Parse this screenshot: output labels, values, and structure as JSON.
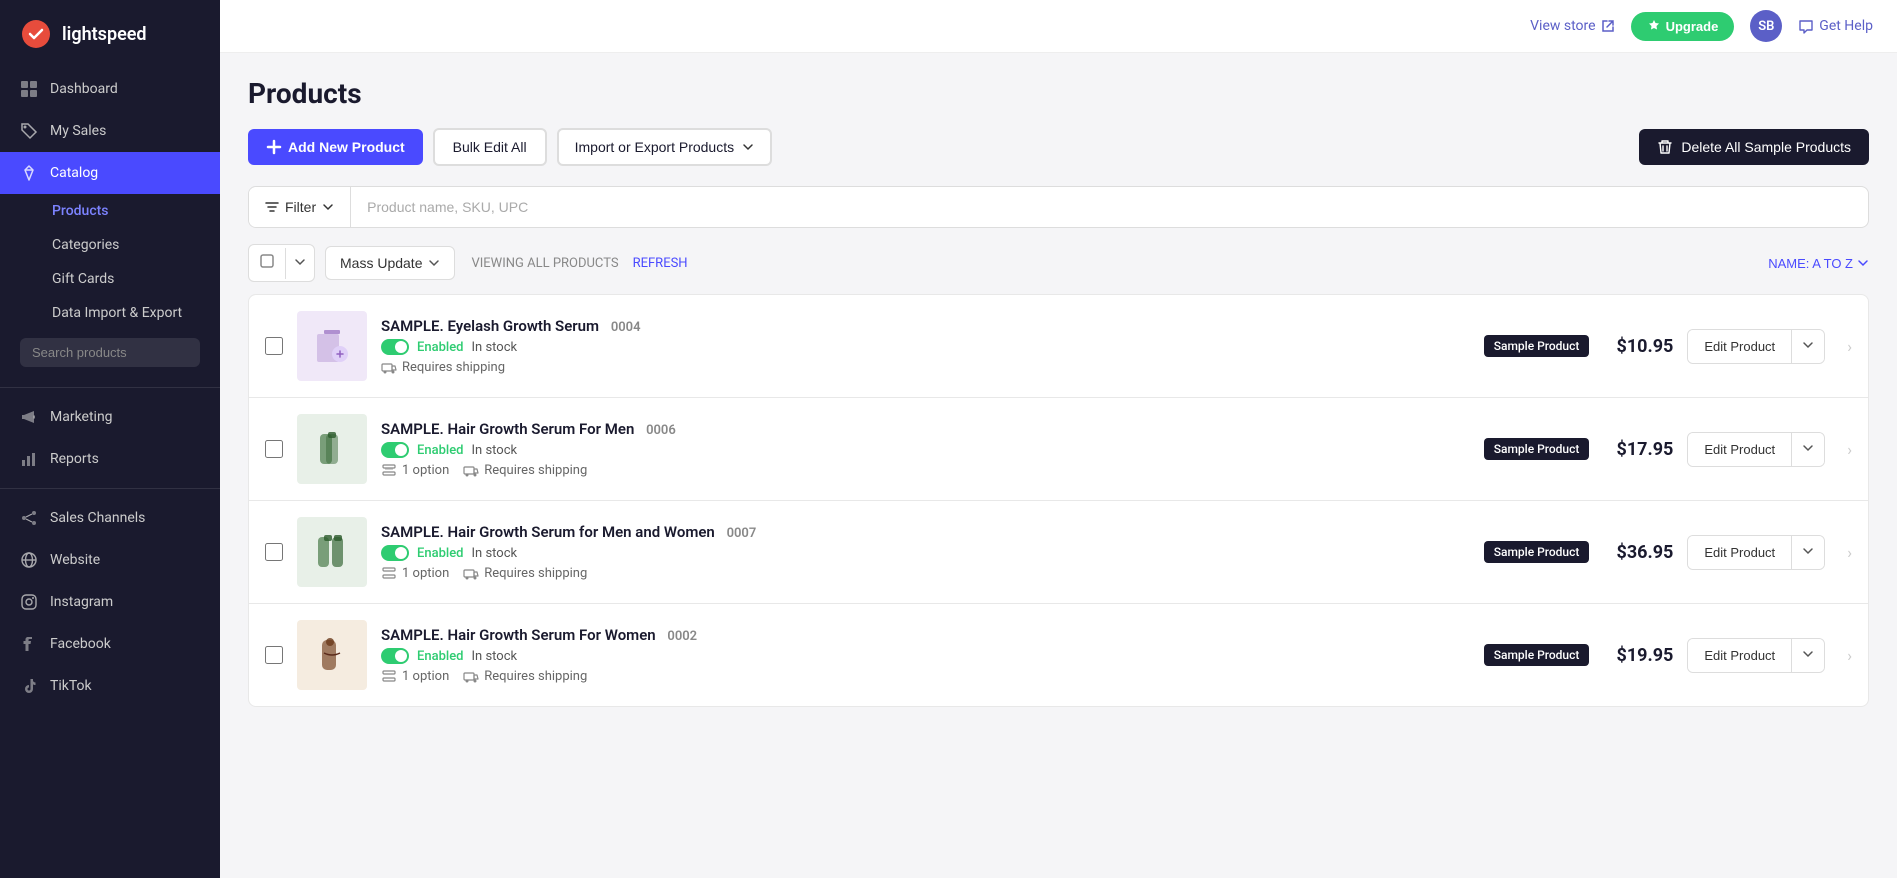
{
  "sidebar": {
    "logo_text": "lightspeed",
    "nav_items": [
      {
        "id": "dashboard",
        "label": "Dashboard",
        "icon": "grid"
      },
      {
        "id": "my-sales",
        "label": "My Sales",
        "icon": "tag"
      },
      {
        "id": "catalog",
        "label": "Catalog",
        "icon": "diamond",
        "active": true
      }
    ],
    "sub_items": [
      {
        "id": "products",
        "label": "Products",
        "active": true
      },
      {
        "id": "categories",
        "label": "Categories"
      },
      {
        "id": "gift-cards",
        "label": "Gift Cards"
      },
      {
        "id": "data-import",
        "label": "Data Import & Export"
      }
    ],
    "search_placeholder": "Search products",
    "bottom_nav": [
      {
        "id": "marketing",
        "label": "Marketing",
        "icon": "megaphone"
      },
      {
        "id": "reports",
        "label": "Reports",
        "icon": "chart"
      },
      {
        "id": "sales-channels",
        "label": "Sales Channels",
        "icon": "share"
      },
      {
        "id": "website",
        "label": "Website",
        "icon": "globe"
      },
      {
        "id": "instagram",
        "label": "Instagram",
        "icon": "instagram"
      },
      {
        "id": "facebook",
        "label": "Facebook",
        "icon": "facebook"
      },
      {
        "id": "tiktok",
        "label": "TikTok",
        "icon": "tiktok"
      }
    ]
  },
  "topbar": {
    "view_store_label": "View store",
    "upgrade_label": "Upgrade",
    "avatar_initials": "SB",
    "get_help_label": "Get Help"
  },
  "page": {
    "title": "Products",
    "add_button": "Add New Product",
    "bulk_edit_button": "Bulk Edit All",
    "import_export_button": "Import or Export Products",
    "delete_samples_button": "Delete All Sample Products",
    "filter_label": "Filter",
    "search_placeholder": "Product name, SKU, UPC",
    "mass_update_label": "Mass Update",
    "viewing_text": "VIEWING ALL PRODUCTS",
    "refresh_label": "REFRESH",
    "sort_label": "NAME: A TO Z",
    "products": [
      {
        "id": "p1",
        "name": "SAMPLE. Eyelash Growth Serum",
        "sku": "0004",
        "status": "Enabled",
        "stock": "In stock",
        "is_sample": true,
        "price": "$10.95",
        "options": null,
        "requires_shipping": true,
        "img_bg": "#e8e0f0"
      },
      {
        "id": "p2",
        "name": "SAMPLE. Hair Growth Serum For Men",
        "sku": "0006",
        "status": "Enabled",
        "stock": "In stock",
        "is_sample": true,
        "price": "$17.95",
        "options": "1 option",
        "requires_shipping": true,
        "img_bg": "#e0e8e0"
      },
      {
        "id": "p3",
        "name": "SAMPLE. Hair Growth Serum for Men and Women",
        "sku": "0007",
        "status": "Enabled",
        "stock": "In stock",
        "is_sample": true,
        "price": "$36.95",
        "options": "1 option",
        "requires_shipping": true,
        "img_bg": "#e0e8e0"
      },
      {
        "id": "p4",
        "name": "SAMPLE. Hair Growth Serum For Women",
        "sku": "0002",
        "status": "Enabled",
        "stock": "In stock",
        "is_sample": true,
        "price": "$19.95",
        "options": "1 option",
        "requires_shipping": true,
        "img_bg": "#f0e8e0"
      }
    ],
    "edit_button_label": "Edit Product",
    "sample_badge_label": "Sample Product",
    "in_stock_label": "In stock",
    "enabled_label": "Enabled",
    "requires_shipping_label": "Requires shipping",
    "option_label": "1 option"
  }
}
